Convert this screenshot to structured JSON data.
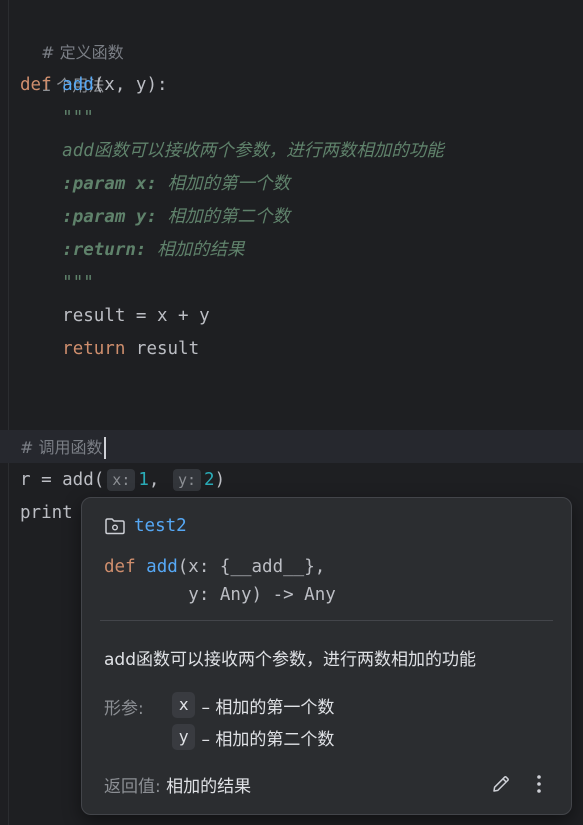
{
  "editor": {
    "lines": {
      "comment_define": "# 定义函数",
      "usages": "1 个用法",
      "def_kw": "def",
      "def_name": "add",
      "def_params": "(x, y):",
      "doc_open": "\"\"\"",
      "doc_desc": "add函数可以接收两个参数，进行两数相加的功能",
      "doc_param_x_tag": ":param x:",
      "doc_param_x_text": "相加的第一个数",
      "doc_param_y_tag": ":param y:",
      "doc_param_y_text": "相加的第二个数",
      "doc_return_tag": ":return:",
      "doc_return_text": "相加的结果",
      "doc_close": "\"\"\"",
      "result_assign": "result = x + y",
      "return_kw": "return",
      "return_val": " result",
      "comment_call": "# 调用函数",
      "call_prefix": "r = add(",
      "hint_x": "x:",
      "arg_1": "1",
      "comma": ", ",
      "hint_y": "y:",
      "arg_2": "2",
      "call_close": ")",
      "print_text": "print"
    }
  },
  "popup": {
    "module_icon": "folder-module-icon",
    "module_name": "test2",
    "sig_line1_kw": "def",
    "sig_line1_name": "add",
    "sig_line1_rest": "(x: {__add__},",
    "sig_line2": "        y: Any) -> Any",
    "description": "add函数可以接收两个参数，进行两数相加的功能",
    "params_label": "形参:",
    "params": [
      {
        "name": "x",
        "text": "– 相加的第一个数"
      },
      {
        "name": "y",
        "text": "– 相加的第二个数"
      }
    ],
    "returns_label": "返回值: ",
    "returns_value": "相加的结果",
    "edit_icon": "pencil-icon",
    "more_icon": "more-vertical-icon"
  }
}
